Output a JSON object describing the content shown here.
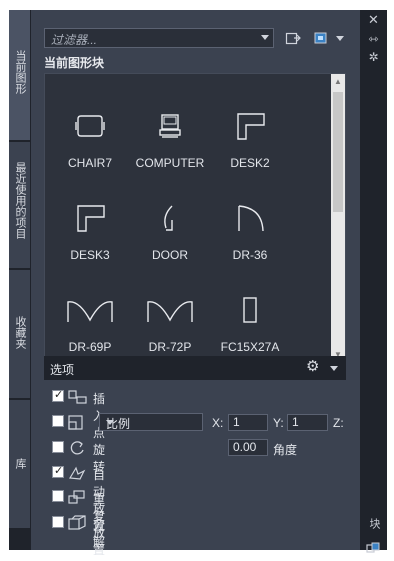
{
  "palette": {
    "background": "#3b4250",
    "dark": "#1f232b",
    "text": "#e3e6eb"
  },
  "left_tabs": [
    {
      "label": "当前图形",
      "active": true
    },
    {
      "label": "最近使用的项目",
      "active": false
    },
    {
      "label": "收藏夹",
      "active": false
    },
    {
      "label": "库",
      "active": false
    }
  ],
  "right_bar": {
    "close_icon": "close-icon",
    "pin_icon": "pin-icon",
    "settings_icon": "settings-icon",
    "label": "块"
  },
  "filter": {
    "placeholder": "过滤器..."
  },
  "section_title": "当前图形块",
  "blocks": [
    {
      "name": "CHAIR7",
      "icon": "chair-icon"
    },
    {
      "name": "COMPUTER",
      "icon": "computer-icon"
    },
    {
      "name": "DESK2",
      "icon": "desk-icon"
    },
    {
      "name": "DESK3",
      "icon": "desk-icon"
    },
    {
      "name": "DOOR",
      "icon": "door-icon"
    },
    {
      "name": "DR-36",
      "icon": "door-icon"
    },
    {
      "name": "DR-69P",
      "icon": "double-door-icon"
    },
    {
      "name": "DR-72P",
      "icon": "double-door-icon"
    },
    {
      "name": "FC15X27A",
      "icon": "rectangle-icon"
    }
  ],
  "options": {
    "title": "选项",
    "insert_point": {
      "label": "插入点",
      "checked": true
    },
    "scale": {
      "checked": false,
      "mode": "比例",
      "x_label": "X:",
      "x_value": "1",
      "y_label": "Y:",
      "y_value": "1",
      "z_label": "Z:"
    },
    "rotate": {
      "label": "旋转",
      "checked": false,
      "angle_value": "0.00",
      "angle_label": "角度"
    },
    "auto_place": {
      "label": "自动放置",
      "checked": true
    },
    "repeat_place": {
      "label": "重复放置",
      "checked": false
    },
    "explode": {
      "label": "分解",
      "checked": false
    }
  }
}
